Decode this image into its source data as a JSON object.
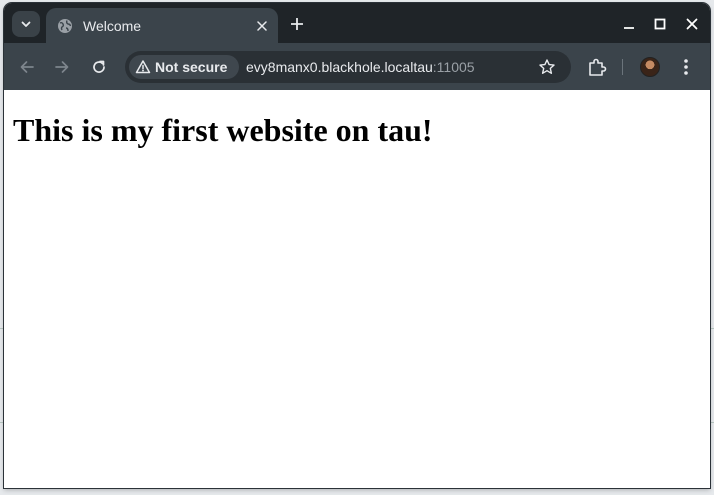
{
  "tab": {
    "title": "Welcome",
    "favicon_icon": "globe-icon"
  },
  "toolbar": {
    "security_label": "Not secure",
    "url_host": "evy8manx0.blackhole.localtau",
    "url_port": ":11005"
  },
  "page": {
    "heading": "This is my first website on tau!"
  },
  "colors": {
    "titlebar": "#1f2428",
    "toolbar": "#3b444b",
    "omnibox": "#2a3035",
    "page_background": "#ffffff"
  }
}
